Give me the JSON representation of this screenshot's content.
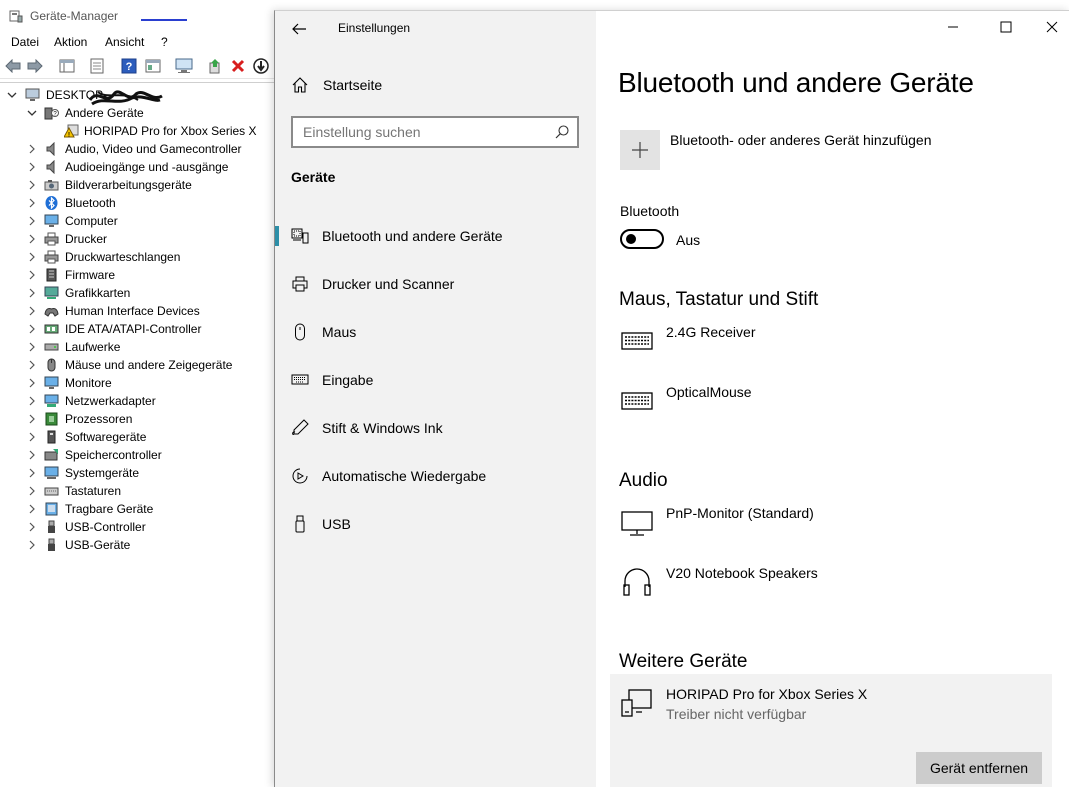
{
  "device_manager": {
    "title": "Geräte-Manager",
    "menu": [
      "Datei",
      "Aktion",
      "Ansicht",
      "?"
    ],
    "root": "DESKTOP-",
    "tree": [
      {
        "label": "Andere Geräte",
        "expanded": true,
        "icon": "unknown-device-icon"
      },
      {
        "label": "HORIPAD Pro for Xbox Series X",
        "child": true,
        "icon": "warning-device-icon"
      },
      {
        "label": "Audio, Video und Gamecontroller",
        "icon": "speaker-icon"
      },
      {
        "label": "Audioeingänge und -ausgänge",
        "icon": "speaker-icon"
      },
      {
        "label": "Bildverarbeitungsgeräte",
        "icon": "camera-icon"
      },
      {
        "label": "Bluetooth",
        "icon": "bluetooth-icon"
      },
      {
        "label": "Computer",
        "icon": "monitor-icon"
      },
      {
        "label": "Drucker",
        "icon": "printer-icon"
      },
      {
        "label": "Druckwarteschlangen",
        "icon": "printer-icon"
      },
      {
        "label": "Firmware",
        "icon": "chip-icon"
      },
      {
        "label": "Grafikkarten",
        "icon": "display-adapter-icon"
      },
      {
        "label": "Human Interface Devices",
        "icon": "hid-icon"
      },
      {
        "label": "IDE ATA/ATAPI-Controller",
        "icon": "ide-icon"
      },
      {
        "label": "Laufwerke",
        "icon": "drive-icon"
      },
      {
        "label": "Mäuse und andere Zeigegeräte",
        "icon": "mouse-icon"
      },
      {
        "label": "Monitore",
        "icon": "monitor-icon"
      },
      {
        "label": "Netzwerkadapter",
        "icon": "network-icon"
      },
      {
        "label": "Prozessoren",
        "icon": "cpu-icon"
      },
      {
        "label": "Softwaregeräte",
        "icon": "software-device-icon"
      },
      {
        "label": "Speichercontroller",
        "icon": "storage-controller-icon"
      },
      {
        "label": "Systemgeräte",
        "icon": "system-device-icon"
      },
      {
        "label": "Tastaturen",
        "icon": "keyboard-icon"
      },
      {
        "label": "Tragbare Geräte",
        "icon": "portable-device-icon"
      },
      {
        "label": "USB-Controller",
        "icon": "usb-icon"
      },
      {
        "label": "USB-Geräte",
        "icon": "usb-icon"
      }
    ]
  },
  "settings": {
    "app_title": "Einstellungen",
    "home": "Startseite",
    "search_placeholder": "Einstellung suchen",
    "section": "Geräte",
    "nav": [
      {
        "label": "Bluetooth und andere Geräte",
        "icon": "bluetooth-devices-icon",
        "active": true
      },
      {
        "label": "Drucker und Scanner",
        "icon": "printer-icon"
      },
      {
        "label": "Maus",
        "icon": "mouse-icon"
      },
      {
        "label": "Eingabe",
        "icon": "keyboard-icon"
      },
      {
        "label": "Stift & Windows Ink",
        "icon": "pen-icon"
      },
      {
        "label": "Automatische Wiedergabe",
        "icon": "autoplay-icon"
      },
      {
        "label": "USB",
        "icon": "usb-icon"
      }
    ],
    "page_title": "Bluetooth und andere Geräte",
    "add_device": "Bluetooth- oder anderes Gerät hinzufügen",
    "bluetooth_label": "Bluetooth",
    "bluetooth_state": "Aus",
    "bluetooth_on": false,
    "groups": {
      "input": {
        "title": "Maus, Tastatur und Stift",
        "devices": [
          {
            "name": "2.4G Receiver",
            "icon": "keyboard-icon"
          },
          {
            "name": "OpticalMouse",
            "icon": "keyboard-icon"
          }
        ]
      },
      "audio": {
        "title": "Audio",
        "devices": [
          {
            "name": "PnP-Monitor (Standard)",
            "icon": "monitor-icon"
          },
          {
            "name": "V20 Notebook Speakers",
            "icon": "headphones-icon"
          }
        ]
      },
      "other": {
        "title": "Weitere Geräte",
        "devices": [
          {
            "name": "HORIPAD Pro for Xbox Series X",
            "status": "Treiber nicht verfügbar",
            "icon": "generic-device-icon"
          }
        ],
        "remove_button": "Gerät entfernen"
      }
    }
  },
  "colors": {
    "accent": "#2d8fa8",
    "nav_background": "#f2f2f2",
    "button_gray": "#cccccc",
    "error_red": "#d81e1e"
  }
}
